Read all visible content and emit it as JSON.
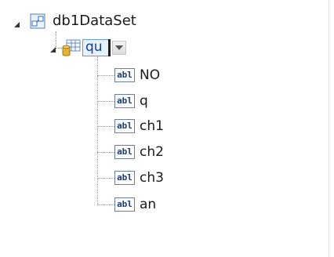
{
  "tree": {
    "root": {
      "label": "db1DataSet",
      "icon": "dataset-icon"
    },
    "table": {
      "label": "qu",
      "icon": "table-icon",
      "dropdown_icon": "chevron-down-icon"
    },
    "columns": [
      {
        "badge": "abl",
        "label": "NO"
      },
      {
        "badge": "abl",
        "label": "q"
      },
      {
        "badge": "abl",
        "label": "ch1"
      },
      {
        "badge": "abl",
        "label": "ch2"
      },
      {
        "badge": "abl",
        "label": "ch3"
      },
      {
        "badge": "abl",
        "label": "an"
      }
    ]
  },
  "colors": {
    "selection_border": "#6a9ad0",
    "selection_fill": "#e7f0fb",
    "tree_lines": "#9a9a9a"
  }
}
